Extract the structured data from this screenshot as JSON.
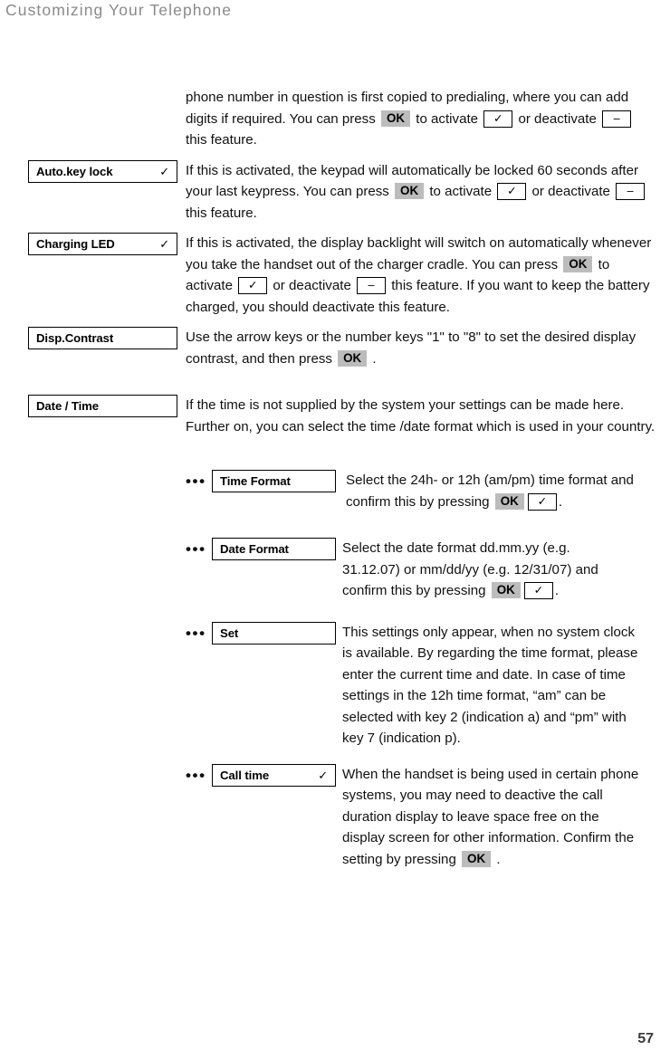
{
  "header": {
    "title": "Customizing Your Telephone"
  },
  "page_number": "57",
  "keys": {
    "ok": "OK",
    "check": "✓",
    "dash": "–"
  },
  "sections": [
    {
      "id": "predialing",
      "label": null,
      "check": null,
      "text_parts": [
        {
          "t": "text",
          "v": "phone number in question is first copied to predialing, where you can add digits if required.  You can press "
        },
        {
          "t": "ok"
        },
        {
          "t": "text",
          "v": " to activate "
        },
        {
          "t": "check"
        },
        {
          "t": "text",
          "v": " or deactivate "
        },
        {
          "t": "dash"
        },
        {
          "t": "text",
          "v": " this feature."
        }
      ]
    },
    {
      "id": "auto-key-lock",
      "label": "Auto.key lock",
      "check": "✓",
      "text_parts": [
        {
          "t": "text",
          "v": "If this is activated, the keypad will automatically be locked 60 seconds after your last keypress.  You can press "
        },
        {
          "t": "ok"
        },
        {
          "t": "text",
          "v": " to activate "
        },
        {
          "t": "check"
        },
        {
          "t": "text",
          "v": " or deactivate "
        },
        {
          "t": "dash"
        },
        {
          "t": "text",
          "v": " this feature."
        }
      ]
    },
    {
      "id": "charging-led",
      "label": "Charging LED",
      "check": "✓",
      "text_parts": [
        {
          "t": "text",
          "v": "If this is activated, the display backlight will switch on automatically whenever you take the handset out of the charger cradle. You can press "
        },
        {
          "t": "ok"
        },
        {
          "t": "text",
          "v": " to activate "
        },
        {
          "t": "check"
        },
        {
          "t": "text",
          "v": " or deactivate "
        },
        {
          "t": "dash"
        },
        {
          "t": "text",
          "v": " this feature. If you want to keep the battery charged, you should deactivate this feature."
        }
      ]
    },
    {
      "id": "disp-contrast",
      "label": "Disp.Contrast",
      "check": null,
      "text_parts": [
        {
          "t": "text",
          "v": "Use the arrow keys or the number keys \"1\" to \"8\" to set the desired display contrast, and then press "
        },
        {
          "t": "ok"
        },
        {
          "t": "text",
          "v": " ."
        }
      ]
    },
    {
      "id": "date-time",
      "label": "Date / Time",
      "check": null,
      "text_parts": [
        {
          "t": "text",
          "v": "If the time is not supplied by the system your settings can be made here. Further on, you can select the time /date format which is used in your country."
        }
      ]
    }
  ],
  "sub_sections": [
    {
      "id": "time-format",
      "bullet": "•••",
      "label": "Time Format",
      "check": null,
      "text_parts": [
        {
          "t": "text",
          "v": "Select the 24h- or 12h (am/pm) time format and confirm this by pressing "
        },
        {
          "t": "ok"
        },
        {
          "t": "check"
        },
        {
          "t": "text",
          "v": "."
        }
      ]
    },
    {
      "id": "date-format",
      "bullet": "•••",
      "label": "Date Format",
      "check": null,
      "text_parts": [
        {
          "t": "text",
          "v": "Select the date format dd.mm.yy (e.g. 31.12.07) or mm/dd/yy (e.g. 12/31/07) and confirm this by pressing "
        },
        {
          "t": "ok"
        },
        {
          "t": "check"
        },
        {
          "t": "text",
          "v": "."
        }
      ]
    },
    {
      "id": "set",
      "bullet": "•••",
      "label": "Set",
      "check": null,
      "text_parts": [
        {
          "t": "text",
          "v": "This settings only appear, when no system clock is available. By regarding the time format, please enter the current time and date. In case of time settings in the 12h time format, “am” can be selected with key 2 (indication a) and  “pm” with key 7 (indication p)."
        }
      ]
    },
    {
      "id": "call-time",
      "bullet": "•••",
      "label": "Call time",
      "check": "✓",
      "text_parts": [
        {
          "t": "text",
          "v": "When the handset is being used in certain phone systems, you may need to deactive the call duration display to leave space free on the display screen for other information. Confirm the setting by pressing "
        },
        {
          "t": "ok"
        },
        {
          "t": "text",
          "v": " ."
        }
      ]
    }
  ]
}
